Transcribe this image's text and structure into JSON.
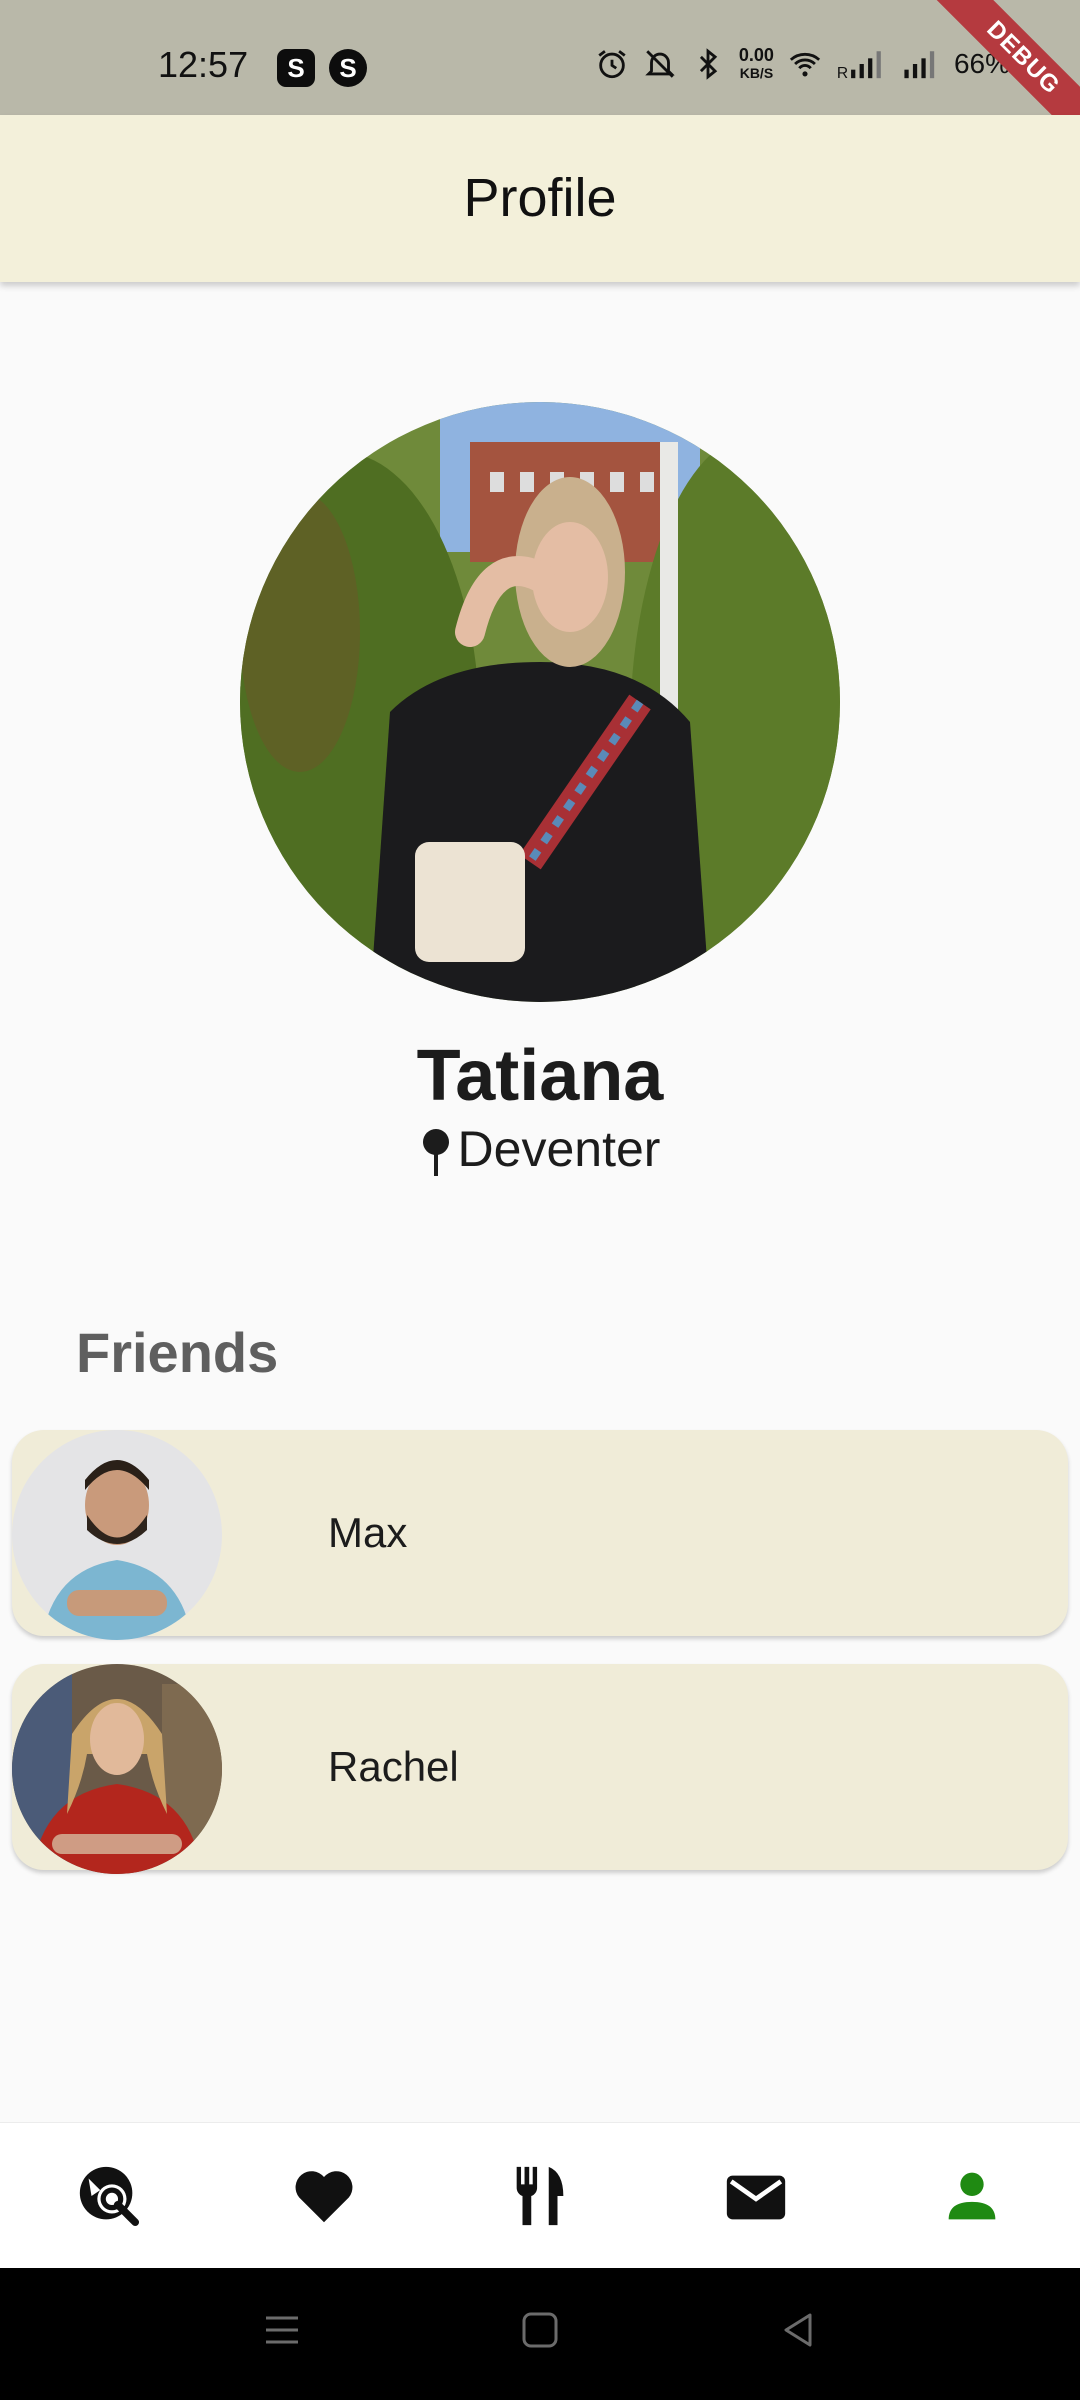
{
  "status_bar": {
    "time": "12:57",
    "speed_value": "0.00",
    "speed_unit": "KB/S",
    "battery": "66%",
    "debug_label": "DEBUG"
  },
  "appbar": {
    "title": "Profile"
  },
  "profile": {
    "name": "Tatiana",
    "location": "Deventer"
  },
  "friends": {
    "heading": "Friends",
    "items": [
      {
        "name": "Max"
      },
      {
        "name": "Rachel"
      }
    ]
  },
  "bottom_nav": {
    "items": [
      {
        "icon": "explore-search-icon",
        "active": false
      },
      {
        "icon": "heart-icon",
        "active": false
      },
      {
        "icon": "restaurant-icon",
        "active": false
      },
      {
        "icon": "mail-icon",
        "active": false
      },
      {
        "icon": "person-icon",
        "active": true
      }
    ],
    "active_color": "#1f8a12",
    "inactive_color": "#111111"
  },
  "colors": {
    "appbar_bg": "#f3f0da",
    "card_bg": "#f0ecd8",
    "status_bar_bg": "#b9b8a9",
    "debug_ribbon": "#b53a3f"
  }
}
